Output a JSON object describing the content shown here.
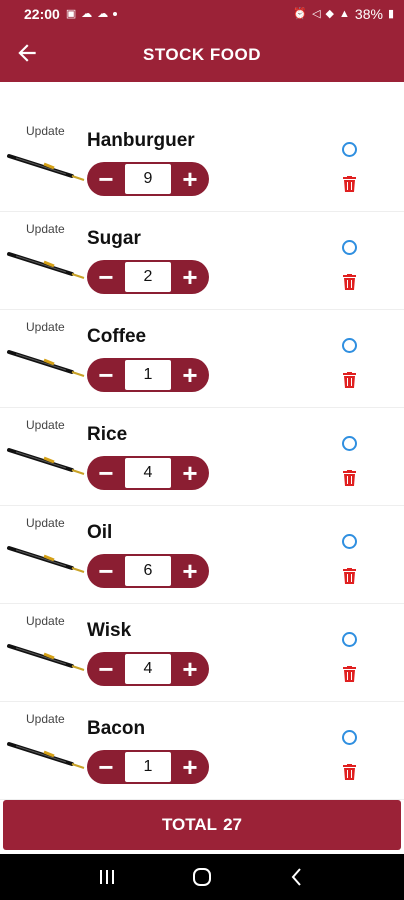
{
  "status_bar": {
    "time": "22:00",
    "battery": "38%"
  },
  "app_bar": {
    "title": "STOCK FOOD"
  },
  "items": [
    {
      "update_label": "Update",
      "name": "Hanburguer",
      "qty": "9"
    },
    {
      "update_label": "Update",
      "name": "Sugar",
      "qty": "2"
    },
    {
      "update_label": "Update",
      "name": "Coffee",
      "qty": "1"
    },
    {
      "update_label": "Update",
      "name": "Rice",
      "qty": "4"
    },
    {
      "update_label": "Update",
      "name": "Oil",
      "qty": "6"
    },
    {
      "update_label": "Update",
      "name": "Wisk",
      "qty": "4"
    },
    {
      "update_label": "Update",
      "name": "Bacon",
      "qty": "1"
    }
  ],
  "stepper": {
    "minus": "−",
    "plus": "+"
  },
  "total": {
    "label": "TOTAL",
    "value": "27"
  },
  "colors": {
    "primary": "#9b2237",
    "stepper": "#8b1e32",
    "radio": "#2f8fe0",
    "trash": "#e02020"
  }
}
